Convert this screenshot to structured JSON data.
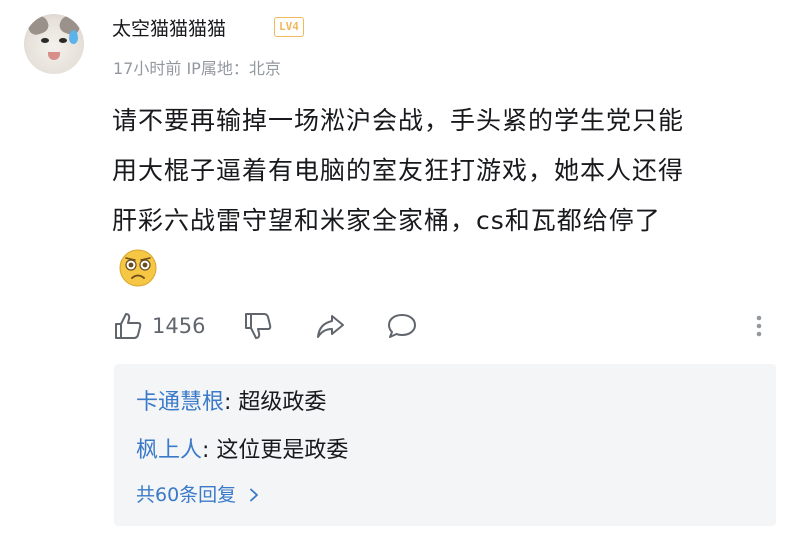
{
  "comment": {
    "username": "太空猫猫猫猫",
    "level_badge": "LV4",
    "meta": "17小时前 IP属地：北京",
    "content_lines": [
      "请不要再输掉一场淞沪会战，手头紧的学生党只能",
      "用大棍子逼着有电脑的室友狂打游戏，她本人还得",
      "肝彩六战雷守望和米家全家桶，cs和瓦都给停了"
    ],
    "emoji": "worried-face-icon",
    "like_count": "1456"
  },
  "replies": {
    "items": [
      {
        "author": "卡通慧根",
        "separator": ": ",
        "text": "超级政委"
      },
      {
        "author": "枫上人",
        "separator": ": ",
        "text": "这位更是政委"
      }
    ],
    "more_label": "共60条回复"
  },
  "colors": {
    "link_blue": "#3b7ac9",
    "meta_gray": "#9499a0",
    "badge_orange": "#f1b85c",
    "reply_bg": "#f4f5f7"
  }
}
